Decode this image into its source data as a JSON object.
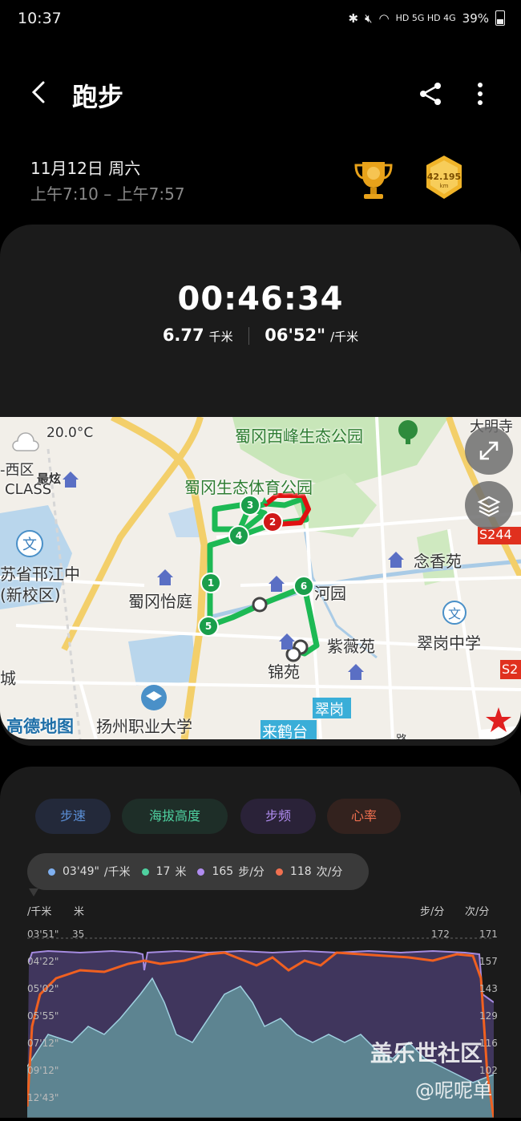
{
  "status_bar": {
    "time": "10:37",
    "network": "HD 5G HD 4G",
    "battery": "39%"
  },
  "header": {
    "title": "跑步"
  },
  "session": {
    "date": "11月12日 周六",
    "time_range": "上午7:10 – 上午7:57",
    "badge_distance": "42.195",
    "badge_unit": "km"
  },
  "summary": {
    "duration": "00:46:34",
    "distance": "6.77",
    "distance_unit": "千米",
    "pace": "06'52\"",
    "pace_unit": "/千米"
  },
  "map": {
    "temperature": "20.0°C",
    "labels": {
      "park_west": "蜀冈西峰生态公园",
      "park_sport": "蜀冈生态体育公园",
      "district": "-西区",
      "shop": "最炫",
      "class": "CLASS",
      "school1": "苏省邗江中",
      "school1b": "(新校区)",
      "yiting": "蜀冈怡庭",
      "hehe": "河园",
      "nianxiang": "念香苑",
      "ziwei": "紫薇苑",
      "jin": "锦苑",
      "cuigang_mid": "翠岗中学",
      "cuigang": "翠岗",
      "laihe": "来鹤台",
      "college": "扬州职业大学",
      "logo": "高德地图",
      "cheng": "城",
      "daming": "大明寺",
      "s244": "S244",
      "s2": "S2",
      "lu": "路"
    },
    "markers": [
      "1",
      "2",
      "3",
      "4",
      "5",
      "6"
    ],
    "route_color": "#1db954"
  },
  "tabs": [
    {
      "label": "步速",
      "color": "#5b8fd6",
      "bg": "#23293a"
    },
    {
      "label": "海拔高度",
      "color": "#4fd1a0",
      "bg": "#1e2e28"
    },
    {
      "label": "步频",
      "color": "#b08cf0",
      "bg": "#2a2238"
    },
    {
      "label": "心率",
      "color": "#f07050",
      "bg": "#33221e"
    }
  ],
  "tooltip": {
    "pace": "03'49\"",
    "pace_unit": "/千米",
    "elev": "17",
    "elev_unit": "米",
    "cadence": "165",
    "cadence_unit": "步/分",
    "hr": "118",
    "hr_unit": "次/分"
  },
  "axes": {
    "left_unit1": "/千米",
    "left_unit2": "米",
    "right_unit1": "步/分",
    "right_unit2": "次/分",
    "pace_ticks": [
      "03'51\"",
      "04'22\"",
      "05'02\"",
      "05'55\"",
      "07'12\"",
      "09'12\"",
      "12'43\""
    ],
    "elev_top": "35",
    "cadence_top": "172",
    "hr_ticks": [
      "171",
      "157",
      "143",
      "129",
      "116",
      "102"
    ]
  },
  "watermark": {
    "line1": "盖乐世社区",
    "line2": "@呢呢单"
  }
}
